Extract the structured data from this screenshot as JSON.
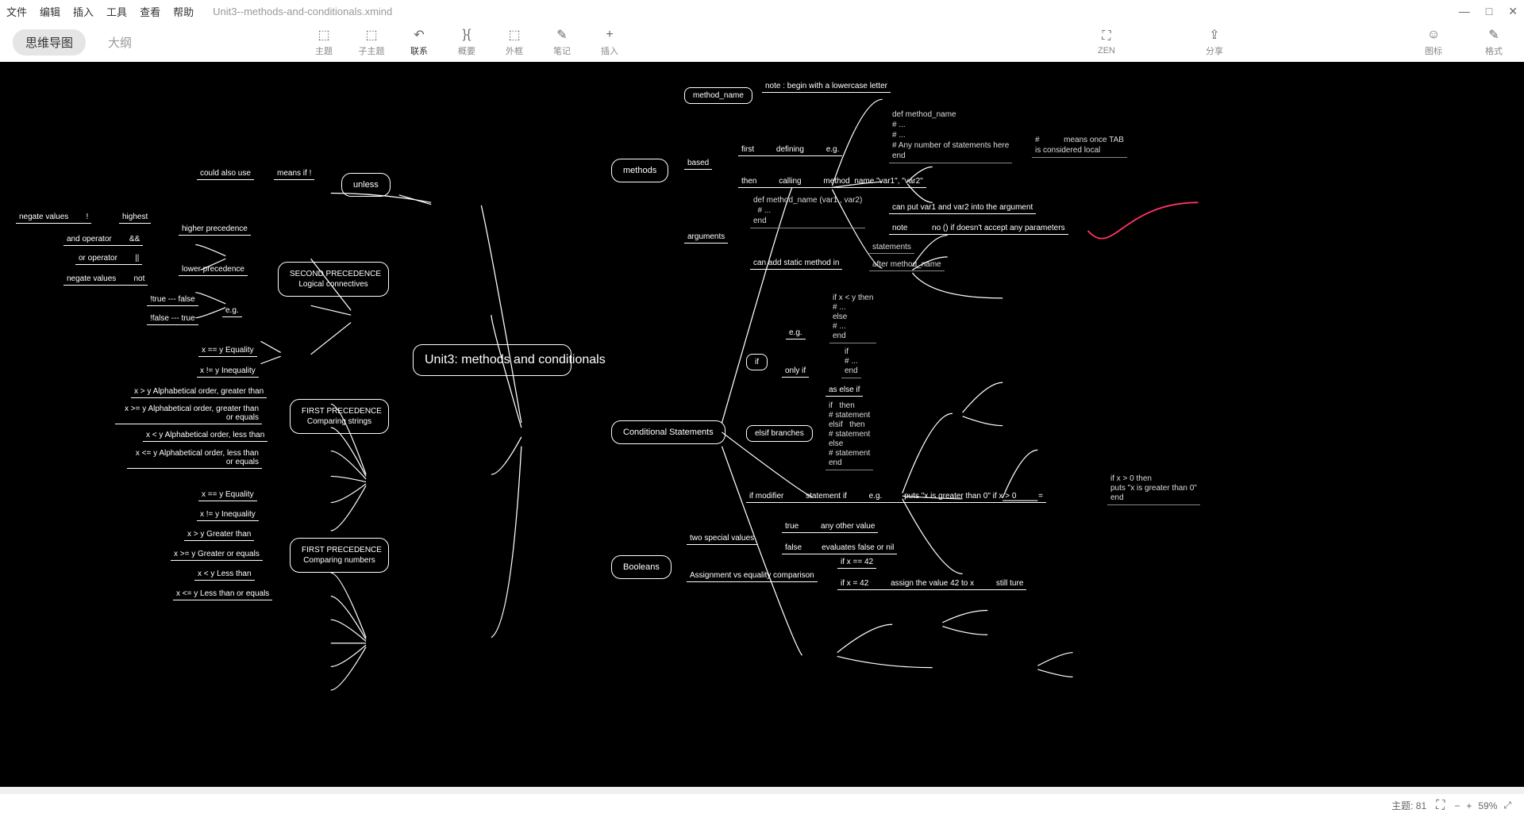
{
  "menu": {
    "file": "文件",
    "edit": "编辑",
    "insert": "插入",
    "tools": "工具",
    "view": "查看",
    "help": "帮助",
    "filename": "Unit3--methods-and-conditionals.xmind"
  },
  "winctrl": {
    "min": "—",
    "max": "□",
    "close": "✕"
  },
  "views": {
    "mindmap": "思维导图",
    "outline": "大纲"
  },
  "tools": {
    "topic": "主题",
    "subtopic": "子主题",
    "relation": "联系",
    "summary": "概要",
    "boundary": "外框",
    "note": "笔记",
    "insert": "插入",
    "zen": "ZEN",
    "share": "分享",
    "icons": "图标",
    "format": "格式"
  },
  "status": {
    "topics_label": "主题:",
    "topics_count": "81",
    "zoom": "59%"
  },
  "chart_data": {
    "type": "mindmap",
    "title": "Unit3:  methods and conditionals",
    "center": "Unit3:  methods and conditionals",
    "branches": {
      "left": [
        {
          "name": "unless",
          "children": [
            {
              "t": "could also use"
            },
            {
              "t": "means if !"
            }
          ]
        },
        {
          "name": "SECOND PRECEDENCE Logical connectives",
          "children": [
            {
              "t": "higher precedence",
              "children": [
                {
                  "t": "negate values",
                  "v": "!"
                },
                {
                  "t": "highest"
                },
                {
                  "t": "and operator",
                  "v": "&&"
                }
              ]
            },
            {
              "t": "lower precedence",
              "children": [
                {
                  "t": "or operator",
                  "v": "||"
                },
                {
                  "t": "negate values",
                  "v": "not"
                }
              ]
            },
            {
              "t": "e.g.",
              "children": [
                {
                  "t": "!true --- false"
                },
                {
                  "t": "!false --- true"
                }
              ]
            }
          ]
        },
        {
          "name": "FIRST PRECEDENCE Comparing strings",
          "children": [
            {
              "t": "x == y Equality"
            },
            {
              "t": "x != y Inequality"
            },
            {
              "t": "x > y Alphabetical order, greater than"
            },
            {
              "t": "x >= y Alphabetical order, greater than or equals"
            },
            {
              "t": "x < y Alphabetical order, less than"
            },
            {
              "t": "x <= y Alphabetical order, less than or equals"
            }
          ]
        },
        {
          "name": "FIRST PRECEDENCE Comparing numbers",
          "children": [
            {
              "t": "x == y Equality"
            },
            {
              "t": "x != y Inequality"
            },
            {
              "t": "x > y Greater than"
            },
            {
              "t": "x >= y Greater or equals"
            },
            {
              "t": "x < y Less than"
            },
            {
              "t": "x <= y Less than or equals"
            }
          ]
        }
      ],
      "right": [
        {
          "name": "methods",
          "children": [
            {
              "t": "method_name",
              "children": [
                {
                  "t": "note : begin with a lowercase letter"
                }
              ]
            },
            {
              "t": "based",
              "children": [
                {
                  "t": "first",
                  "b": "defining",
                  "c": "e.g.",
                  "code": "def method_name\n# ...\n# ...\n# Any number of statements here\nend",
                  "extra": "#           means once TAB\nis considered local"
                },
                {
                  "t": "then",
                  "b": "calling",
                  "c": "method_name \"var1\", \"var2\""
                }
              ]
            },
            {
              "t": "arguments",
              "children": [
                {
                  "code": "def method_name (var1 , var2)\n  # ...\nend",
                  "extra": "can put var1 and var2 into the argument"
                },
                {
                  "t": "note",
                  "extra": "no () if doesn't accept any parameters"
                },
                {
                  "t": "can add static method in",
                  "extra": "statements\nafter method_name"
                }
              ]
            }
          ]
        },
        {
          "name": "Conditional Statements",
          "children": [
            {
              "t": "if",
              "children": [
                {
                  "t": "e.g.",
                  "code": "if x < y then\n# ...\nelse\n# ...\nend"
                },
                {
                  "t": "only if",
                  "code": "if\n# ...\nend"
                }
              ]
            },
            {
              "t": "elsif branches",
              "children": [
                {
                  "t": "as else if"
                },
                {
                  "code": "if   then\n# statement\nelsif   then\n# statement\nelse\n# statement\nend"
                }
              ]
            },
            {
              "t": "if modifier",
              "b": "statement if",
              "c": "e.g.",
              "d": "puts \"x is greater than 0\" if x > 0",
              "e": "=",
              "f": "if x > 0 then\nputs \"x is greater than 0\"\nend"
            }
          ]
        },
        {
          "name": "Booleans",
          "children": [
            {
              "t": "two special values",
              "children": [
                {
                  "t": "true",
                  "v": "any other value"
                },
                {
                  "t": "false",
                  "v": "evaluates false or nil"
                }
              ]
            },
            {
              "t": "Assignment vs equality comparison",
              "children": [
                {
                  "t": "if x == 42"
                },
                {
                  "t": "if x = 42",
                  "v": "assign the value 42 to x",
                  "w": "still ture"
                }
              ]
            }
          ]
        }
      ]
    }
  }
}
